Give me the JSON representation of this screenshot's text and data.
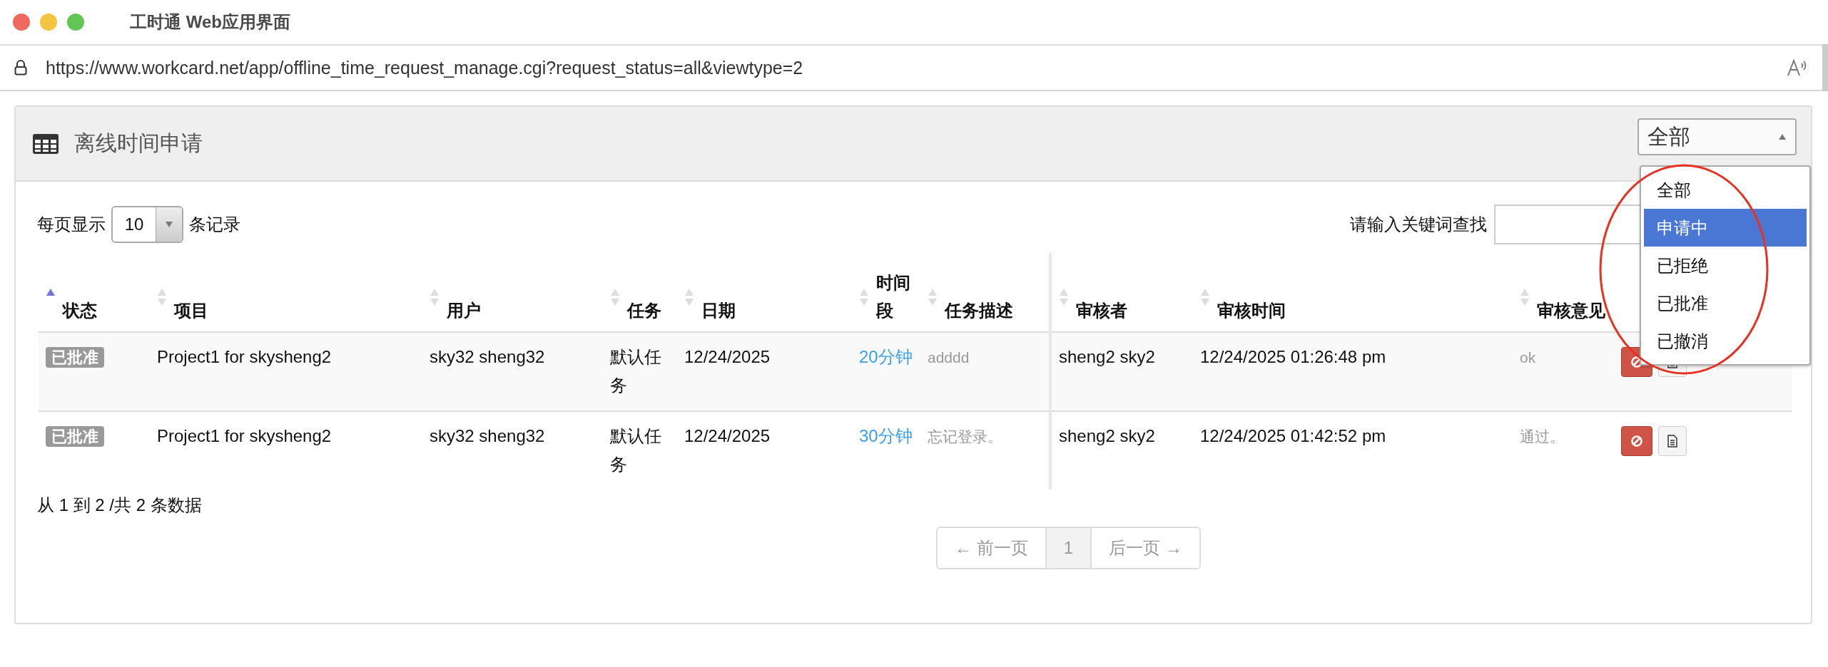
{
  "window": {
    "title": "工时通 Web应用界面"
  },
  "address_bar": {
    "url": "https://www.workcard.net/app/offline_time_request_manage.cgi?request_status=all&viewtype=2"
  },
  "panel": {
    "title": "离线时间申请",
    "status_filter": {
      "value": "全部",
      "expanded": true,
      "options": [
        {
          "label": "全部",
          "highlighted": false
        },
        {
          "label": "申请中",
          "highlighted": true
        },
        {
          "label": "已拒绝",
          "highlighted": false
        },
        {
          "label": "已批准",
          "highlighted": false
        },
        {
          "label": "已撤消",
          "highlighted": false
        }
      ]
    }
  },
  "annotation": {
    "kind": "ellipse"
  },
  "length_control": {
    "prefix": "每页显示",
    "value": "10",
    "suffix": "条记录"
  },
  "search": {
    "label": "请输入关键词查找"
  },
  "table": {
    "columns": [
      {
        "label": "状态",
        "sortable": true,
        "sorted": true
      },
      {
        "label": "项目",
        "sortable": true,
        "sorted": false
      },
      {
        "label": "用户",
        "sortable": true,
        "sorted": false
      },
      {
        "label": "任务",
        "sortable": true,
        "sorted": false
      },
      {
        "label": "日期",
        "sortable": true,
        "sorted": false
      },
      {
        "label": "时间段",
        "sortable": true,
        "sorted": false
      },
      {
        "label": "任务描述",
        "sortable": true,
        "sorted": false
      },
      {
        "label": "审核者",
        "sortable": true,
        "sorted": false
      },
      {
        "label": "审核时间",
        "sortable": true,
        "sorted": false
      },
      {
        "label": "审核意见",
        "sortable": true,
        "sorted": false
      },
      {
        "sortable": false
      }
    ],
    "rows": [
      {
        "status": "已批准",
        "project": "Project1 for skysheng2",
        "user": "sky32 sheng32",
        "task": "默认任务",
        "date": "12/24/2025",
        "duration": "20分钟",
        "description": "adddd",
        "reviewer": "sheng2 sky2",
        "review_time": "12/24/2025 01:26:48 pm",
        "comment": "ok",
        "actions": [
          {
            "kind": "cancel"
          },
          {
            "kind": "detail"
          }
        ]
      },
      {
        "status": "已批准",
        "project": "Project1 for skysheng2",
        "user": "sky32 sheng32",
        "task": "默认任务",
        "date": "12/24/2025",
        "duration": "30分钟",
        "description": "忘记登录。",
        "reviewer": "sheng2 sky2",
        "review_time": "12/24/2025 01:42:52 pm",
        "comment": "通过。",
        "actions": [
          {
            "kind": "cancel"
          },
          {
            "kind": "detail"
          }
        ]
      }
    ]
  },
  "info": "从 1 到 2 /共 2 条数据",
  "pagination": {
    "prev": "← 前一页",
    "pages": [
      {
        "label": "1",
        "selected": true
      }
    ],
    "next": "后一页 →"
  }
}
